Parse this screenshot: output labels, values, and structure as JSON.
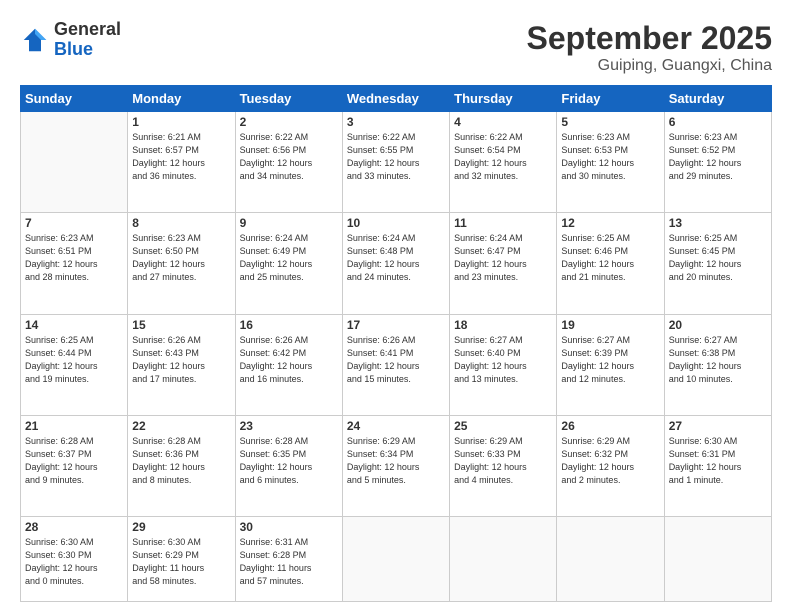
{
  "header": {
    "logo_general": "General",
    "logo_blue": "Blue",
    "month": "September 2025",
    "location": "Guiping, Guangxi, China"
  },
  "days_of_week": [
    "Sunday",
    "Monday",
    "Tuesday",
    "Wednesday",
    "Thursday",
    "Friday",
    "Saturday"
  ],
  "weeks": [
    [
      {
        "day": "",
        "info": ""
      },
      {
        "day": "1",
        "info": "Sunrise: 6:21 AM\nSunset: 6:57 PM\nDaylight: 12 hours\nand 36 minutes."
      },
      {
        "day": "2",
        "info": "Sunrise: 6:22 AM\nSunset: 6:56 PM\nDaylight: 12 hours\nand 34 minutes."
      },
      {
        "day": "3",
        "info": "Sunrise: 6:22 AM\nSunset: 6:55 PM\nDaylight: 12 hours\nand 33 minutes."
      },
      {
        "day": "4",
        "info": "Sunrise: 6:22 AM\nSunset: 6:54 PM\nDaylight: 12 hours\nand 32 minutes."
      },
      {
        "day": "5",
        "info": "Sunrise: 6:23 AM\nSunset: 6:53 PM\nDaylight: 12 hours\nand 30 minutes."
      },
      {
        "day": "6",
        "info": "Sunrise: 6:23 AM\nSunset: 6:52 PM\nDaylight: 12 hours\nand 29 minutes."
      }
    ],
    [
      {
        "day": "7",
        "info": "Sunrise: 6:23 AM\nSunset: 6:51 PM\nDaylight: 12 hours\nand 28 minutes."
      },
      {
        "day": "8",
        "info": "Sunrise: 6:23 AM\nSunset: 6:50 PM\nDaylight: 12 hours\nand 27 minutes."
      },
      {
        "day": "9",
        "info": "Sunrise: 6:24 AM\nSunset: 6:49 PM\nDaylight: 12 hours\nand 25 minutes."
      },
      {
        "day": "10",
        "info": "Sunrise: 6:24 AM\nSunset: 6:48 PM\nDaylight: 12 hours\nand 24 minutes."
      },
      {
        "day": "11",
        "info": "Sunrise: 6:24 AM\nSunset: 6:47 PM\nDaylight: 12 hours\nand 23 minutes."
      },
      {
        "day": "12",
        "info": "Sunrise: 6:25 AM\nSunset: 6:46 PM\nDaylight: 12 hours\nand 21 minutes."
      },
      {
        "day": "13",
        "info": "Sunrise: 6:25 AM\nSunset: 6:45 PM\nDaylight: 12 hours\nand 20 minutes."
      }
    ],
    [
      {
        "day": "14",
        "info": "Sunrise: 6:25 AM\nSunset: 6:44 PM\nDaylight: 12 hours\nand 19 minutes."
      },
      {
        "day": "15",
        "info": "Sunrise: 6:26 AM\nSunset: 6:43 PM\nDaylight: 12 hours\nand 17 minutes."
      },
      {
        "day": "16",
        "info": "Sunrise: 6:26 AM\nSunset: 6:42 PM\nDaylight: 12 hours\nand 16 minutes."
      },
      {
        "day": "17",
        "info": "Sunrise: 6:26 AM\nSunset: 6:41 PM\nDaylight: 12 hours\nand 15 minutes."
      },
      {
        "day": "18",
        "info": "Sunrise: 6:27 AM\nSunset: 6:40 PM\nDaylight: 12 hours\nand 13 minutes."
      },
      {
        "day": "19",
        "info": "Sunrise: 6:27 AM\nSunset: 6:39 PM\nDaylight: 12 hours\nand 12 minutes."
      },
      {
        "day": "20",
        "info": "Sunrise: 6:27 AM\nSunset: 6:38 PM\nDaylight: 12 hours\nand 10 minutes."
      }
    ],
    [
      {
        "day": "21",
        "info": "Sunrise: 6:28 AM\nSunset: 6:37 PM\nDaylight: 12 hours\nand 9 minutes."
      },
      {
        "day": "22",
        "info": "Sunrise: 6:28 AM\nSunset: 6:36 PM\nDaylight: 12 hours\nand 8 minutes."
      },
      {
        "day": "23",
        "info": "Sunrise: 6:28 AM\nSunset: 6:35 PM\nDaylight: 12 hours\nand 6 minutes."
      },
      {
        "day": "24",
        "info": "Sunrise: 6:29 AM\nSunset: 6:34 PM\nDaylight: 12 hours\nand 5 minutes."
      },
      {
        "day": "25",
        "info": "Sunrise: 6:29 AM\nSunset: 6:33 PM\nDaylight: 12 hours\nand 4 minutes."
      },
      {
        "day": "26",
        "info": "Sunrise: 6:29 AM\nSunset: 6:32 PM\nDaylight: 12 hours\nand 2 minutes."
      },
      {
        "day": "27",
        "info": "Sunrise: 6:30 AM\nSunset: 6:31 PM\nDaylight: 12 hours\nand 1 minute."
      }
    ],
    [
      {
        "day": "28",
        "info": "Sunrise: 6:30 AM\nSunset: 6:30 PM\nDaylight: 12 hours\nand 0 minutes."
      },
      {
        "day": "29",
        "info": "Sunrise: 6:30 AM\nSunset: 6:29 PM\nDaylight: 11 hours\nand 58 minutes."
      },
      {
        "day": "30",
        "info": "Sunrise: 6:31 AM\nSunset: 6:28 PM\nDaylight: 11 hours\nand 57 minutes."
      },
      {
        "day": "",
        "info": ""
      },
      {
        "day": "",
        "info": ""
      },
      {
        "day": "",
        "info": ""
      },
      {
        "day": "",
        "info": ""
      }
    ]
  ]
}
